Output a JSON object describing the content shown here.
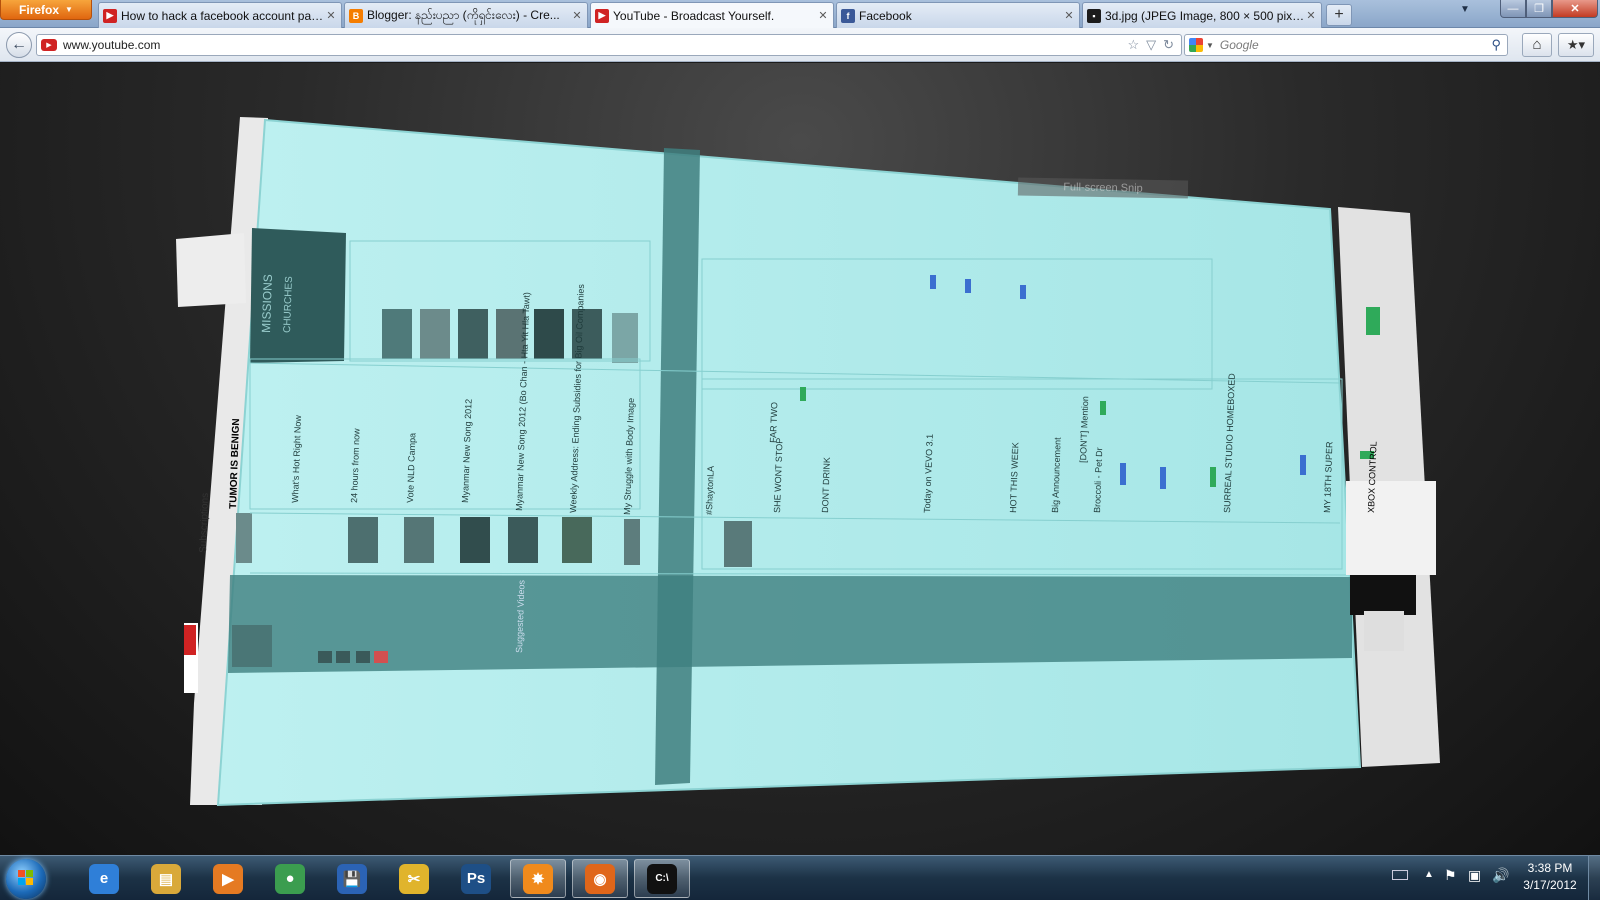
{
  "browser": {
    "app_button_label": "Firefox",
    "tabs": [
      {
        "label": "How to hack a facebook account part...",
        "favicon": "youtube-favicon",
        "active": false
      },
      {
        "label": "Blogger: နည်းပညာ (ကိုရှင်းလေး) - Cre...",
        "favicon": "blogger-favicon",
        "active": false
      },
      {
        "label": "YouTube - Broadcast Yourself.",
        "favicon": "youtube-favicon",
        "active": true
      },
      {
        "label": "Facebook",
        "favicon": "facebook-favicon",
        "active": false
      },
      {
        "label": "3d.jpg (JPEG Image, 800 × 500 pixels)",
        "favicon": "image-favicon",
        "active": false
      }
    ],
    "url": "www.youtube.com",
    "search_placeholder": "Google"
  },
  "page": {
    "fullscreen_snip_label": "Full-screen Snip",
    "visible_fragments": [
      "What's Hot Right Now",
      "24 hours from now",
      "Vote NLD Campa",
      "Myanmar New Song 2012",
      "Myanmar New Song 2012 (Bo Chan - Hta Yit Hla Tawt)",
      "Weekly Address: Ending Subsidies for Big Oil Companies",
      "My Struggle with Body Image",
      "TUMOR IS BENIGN",
      "Subscriptions",
      "#ShaytonLA",
      "SHE WONT STOP",
      "DONT DRINK",
      "FAR TWO",
      "Today on VEVO 3.1",
      "HOT THIS WEEK",
      "Big Announcement",
      "[DON'T] Mention",
      "Broccoli - Pet Dr",
      "SURREAL STUDIO HOMEBOXED",
      "MY 18TH SUPER",
      "XBOX CONTROL",
      "Suggested Videos",
      "MISSIONS",
      "CHURCHES"
    ]
  },
  "taskbar": {
    "apps": [
      {
        "name": "internet-explorer",
        "glyph": "e",
        "color": "#2f7fd8",
        "active": false
      },
      {
        "name": "windows-explorer",
        "glyph": "▤",
        "color": "#d9a93a",
        "active": false
      },
      {
        "name": "media-player",
        "glyph": "▶",
        "color": "#e57a22",
        "active": false
      },
      {
        "name": "google-chrome",
        "glyph": "●",
        "color": "#3b9d4f",
        "active": false
      },
      {
        "name": "save-app",
        "glyph": "💾",
        "color": "#2b63b5",
        "active": false
      },
      {
        "name": "tools-app",
        "glyph": "✂",
        "color": "#e0b42c",
        "active": false
      },
      {
        "name": "photoshop",
        "glyph": "Ps",
        "color": "#1e4f86",
        "active": false
      },
      {
        "name": "avast",
        "glyph": "✸",
        "color": "#f08a1c",
        "active": true
      },
      {
        "name": "firefox",
        "glyph": "◉",
        "color": "#e0661a",
        "active": true
      },
      {
        "name": "command-prompt",
        "glyph": "C:\\",
        "color": "#111111",
        "active": true
      }
    ],
    "clock": {
      "time": "3:38 PM",
      "date": "3/17/2012"
    }
  },
  "colors": {
    "layer_cyan": "#b4ecec",
    "layer_dark": "#3f7f7f",
    "accent_orange": "#e0660f"
  }
}
